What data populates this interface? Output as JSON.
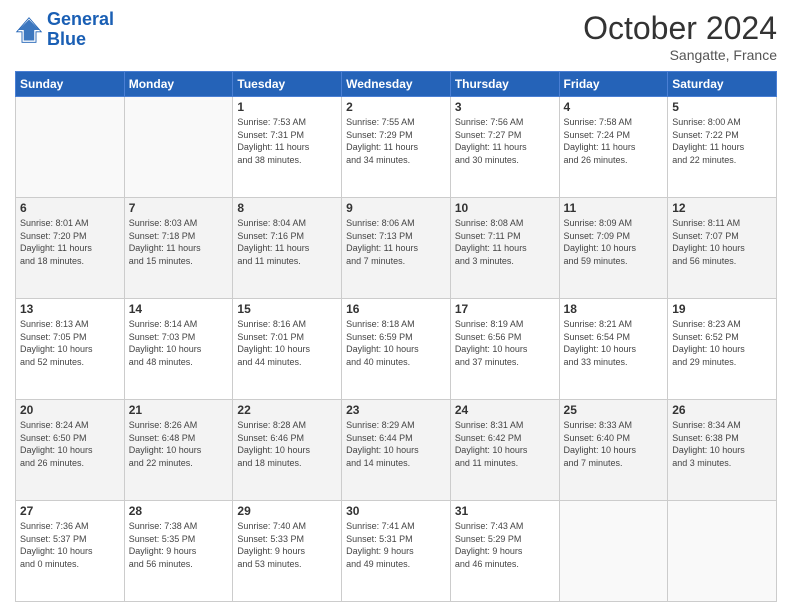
{
  "header": {
    "logo_line1": "General",
    "logo_line2": "Blue",
    "month": "October 2024",
    "location": "Sangatte, France"
  },
  "weekdays": [
    "Sunday",
    "Monday",
    "Tuesday",
    "Wednesday",
    "Thursday",
    "Friday",
    "Saturday"
  ],
  "weeks": [
    [
      {
        "day": "",
        "info": ""
      },
      {
        "day": "",
        "info": ""
      },
      {
        "day": "1",
        "info": "Sunrise: 7:53 AM\nSunset: 7:31 PM\nDaylight: 11 hours\nand 38 minutes."
      },
      {
        "day": "2",
        "info": "Sunrise: 7:55 AM\nSunset: 7:29 PM\nDaylight: 11 hours\nand 34 minutes."
      },
      {
        "day": "3",
        "info": "Sunrise: 7:56 AM\nSunset: 7:27 PM\nDaylight: 11 hours\nand 30 minutes."
      },
      {
        "day": "4",
        "info": "Sunrise: 7:58 AM\nSunset: 7:24 PM\nDaylight: 11 hours\nand 26 minutes."
      },
      {
        "day": "5",
        "info": "Sunrise: 8:00 AM\nSunset: 7:22 PM\nDaylight: 11 hours\nand 22 minutes."
      }
    ],
    [
      {
        "day": "6",
        "info": "Sunrise: 8:01 AM\nSunset: 7:20 PM\nDaylight: 11 hours\nand 18 minutes."
      },
      {
        "day": "7",
        "info": "Sunrise: 8:03 AM\nSunset: 7:18 PM\nDaylight: 11 hours\nand 15 minutes."
      },
      {
        "day": "8",
        "info": "Sunrise: 8:04 AM\nSunset: 7:16 PM\nDaylight: 11 hours\nand 11 minutes."
      },
      {
        "day": "9",
        "info": "Sunrise: 8:06 AM\nSunset: 7:13 PM\nDaylight: 11 hours\nand 7 minutes."
      },
      {
        "day": "10",
        "info": "Sunrise: 8:08 AM\nSunset: 7:11 PM\nDaylight: 11 hours\nand 3 minutes."
      },
      {
        "day": "11",
        "info": "Sunrise: 8:09 AM\nSunset: 7:09 PM\nDaylight: 10 hours\nand 59 minutes."
      },
      {
        "day": "12",
        "info": "Sunrise: 8:11 AM\nSunset: 7:07 PM\nDaylight: 10 hours\nand 56 minutes."
      }
    ],
    [
      {
        "day": "13",
        "info": "Sunrise: 8:13 AM\nSunset: 7:05 PM\nDaylight: 10 hours\nand 52 minutes."
      },
      {
        "day": "14",
        "info": "Sunrise: 8:14 AM\nSunset: 7:03 PM\nDaylight: 10 hours\nand 48 minutes."
      },
      {
        "day": "15",
        "info": "Sunrise: 8:16 AM\nSunset: 7:01 PM\nDaylight: 10 hours\nand 44 minutes."
      },
      {
        "day": "16",
        "info": "Sunrise: 8:18 AM\nSunset: 6:59 PM\nDaylight: 10 hours\nand 40 minutes."
      },
      {
        "day": "17",
        "info": "Sunrise: 8:19 AM\nSunset: 6:56 PM\nDaylight: 10 hours\nand 37 minutes."
      },
      {
        "day": "18",
        "info": "Sunrise: 8:21 AM\nSunset: 6:54 PM\nDaylight: 10 hours\nand 33 minutes."
      },
      {
        "day": "19",
        "info": "Sunrise: 8:23 AM\nSunset: 6:52 PM\nDaylight: 10 hours\nand 29 minutes."
      }
    ],
    [
      {
        "day": "20",
        "info": "Sunrise: 8:24 AM\nSunset: 6:50 PM\nDaylight: 10 hours\nand 26 minutes."
      },
      {
        "day": "21",
        "info": "Sunrise: 8:26 AM\nSunset: 6:48 PM\nDaylight: 10 hours\nand 22 minutes."
      },
      {
        "day": "22",
        "info": "Sunrise: 8:28 AM\nSunset: 6:46 PM\nDaylight: 10 hours\nand 18 minutes."
      },
      {
        "day": "23",
        "info": "Sunrise: 8:29 AM\nSunset: 6:44 PM\nDaylight: 10 hours\nand 14 minutes."
      },
      {
        "day": "24",
        "info": "Sunrise: 8:31 AM\nSunset: 6:42 PM\nDaylight: 10 hours\nand 11 minutes."
      },
      {
        "day": "25",
        "info": "Sunrise: 8:33 AM\nSunset: 6:40 PM\nDaylight: 10 hours\nand 7 minutes."
      },
      {
        "day": "26",
        "info": "Sunrise: 8:34 AM\nSunset: 6:38 PM\nDaylight: 10 hours\nand 3 minutes."
      }
    ],
    [
      {
        "day": "27",
        "info": "Sunrise: 7:36 AM\nSunset: 5:37 PM\nDaylight: 10 hours\nand 0 minutes."
      },
      {
        "day": "28",
        "info": "Sunrise: 7:38 AM\nSunset: 5:35 PM\nDaylight: 9 hours\nand 56 minutes."
      },
      {
        "day": "29",
        "info": "Sunrise: 7:40 AM\nSunset: 5:33 PM\nDaylight: 9 hours\nand 53 minutes."
      },
      {
        "day": "30",
        "info": "Sunrise: 7:41 AM\nSunset: 5:31 PM\nDaylight: 9 hours\nand 49 minutes."
      },
      {
        "day": "31",
        "info": "Sunrise: 7:43 AM\nSunset: 5:29 PM\nDaylight: 9 hours\nand 46 minutes."
      },
      {
        "day": "",
        "info": ""
      },
      {
        "day": "",
        "info": ""
      }
    ]
  ]
}
